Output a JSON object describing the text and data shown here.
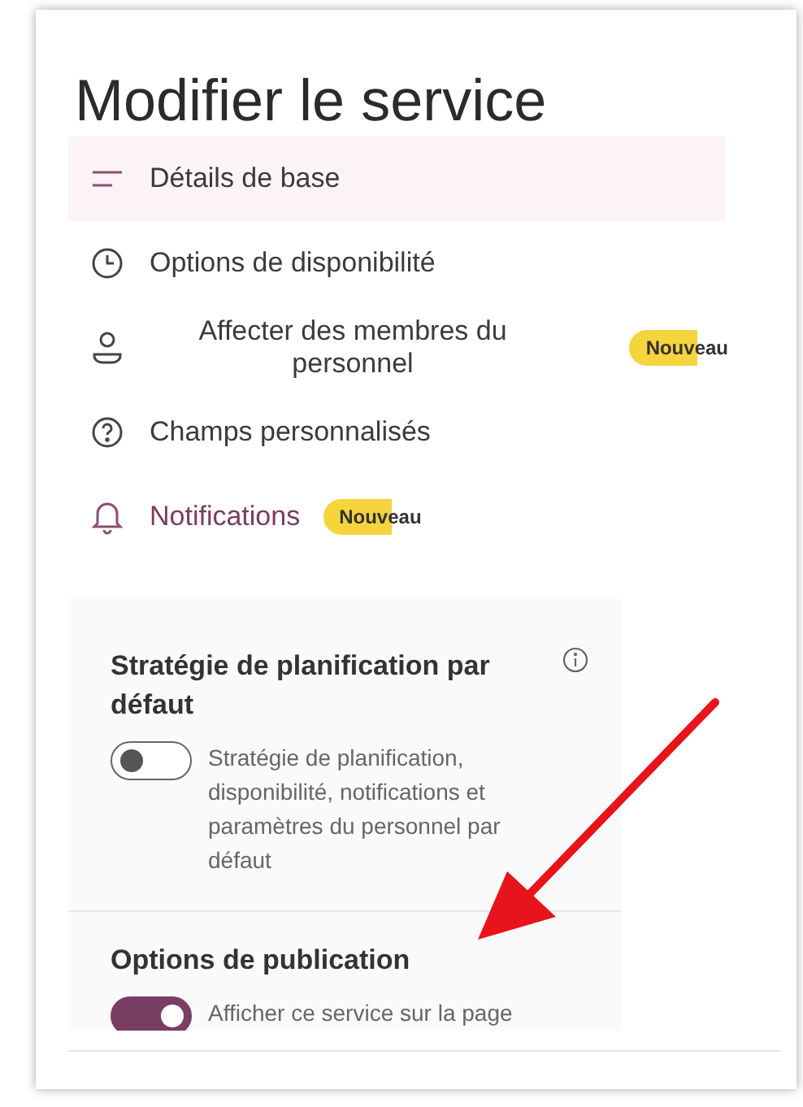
{
  "title": "Modifier le service",
  "nav": [
    {
      "label": "Détails de base",
      "kind": "plain",
      "selected": true,
      "accent": false
    },
    {
      "label": "Options de disponibilité",
      "kind": "plain",
      "selected": false,
      "accent": false
    },
    {
      "label": "Affecter des membres du personnel",
      "kind": "centered",
      "selected": false,
      "accent": false,
      "badge": "Nouveau"
    },
    {
      "label": "Champs personnalisés",
      "kind": "plain",
      "selected": false,
      "accent": false
    },
    {
      "label": "Notifications",
      "kind": "plain",
      "selected": false,
      "accent": true,
      "badge": "Nouveau"
    }
  ],
  "sections": [
    {
      "title": "Stratégie de planification par défaut",
      "info": true,
      "toggle": {
        "on": false,
        "label": "Stratégie de planification, disponibilité, notifications et paramètres du personnel par défaut"
      }
    },
    {
      "title": "Options de publication",
      "toggle": {
        "on": true,
        "label": "Afficher ce service sur la page"
      }
    }
  ]
}
